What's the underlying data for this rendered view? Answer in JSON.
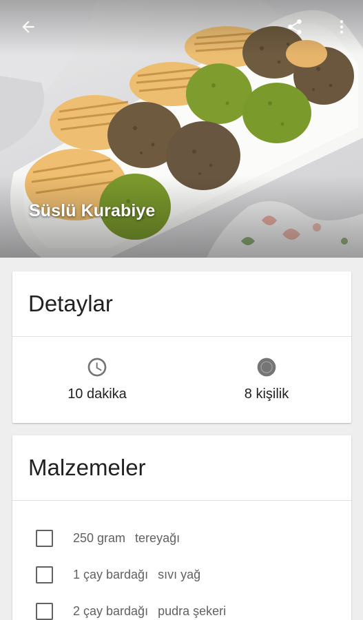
{
  "recipe": {
    "title": "Süslü Kurabiye"
  },
  "icons": {
    "back": "arrow-back-icon",
    "share": "share-icon",
    "more": "more-vert-icon",
    "time": "clock-icon",
    "servings": "servings-icon"
  },
  "details": {
    "header": "Detaylar",
    "time": "10 dakika",
    "servings": "8 kişilik"
  },
  "ingredients": {
    "header": "Malzemeler",
    "items": [
      {
        "amount": "250 gram",
        "name": "tereyağı"
      },
      {
        "amount": "1 çay bardağı",
        "name": "sıvı yağ"
      },
      {
        "amount": "2 çay bardağı",
        "name": "pudra şekeri"
      }
    ]
  },
  "colors": {
    "background": "#eeeeee",
    "card": "#ffffff",
    "icon_grey": "#757575",
    "pistachio": "#7d9a2c",
    "walnut": "#6e5a3d",
    "cookie": "#e8b86a"
  }
}
